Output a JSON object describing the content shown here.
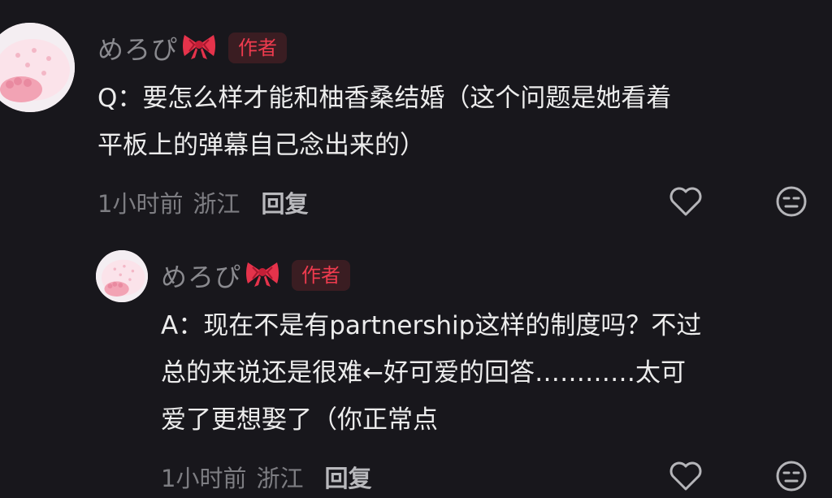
{
  "comments": [
    {
      "username": "めろぴ",
      "badge": "作者",
      "lines": [
        "Q：要怎么样才能和柚香桑结婚（这个问题是她看着",
        "平板上的弹幕自己念出来的）"
      ],
      "time": "1小时前",
      "location": "浙江",
      "reply_label": "回复"
    },
    {
      "username": "めろぴ",
      "badge": "作者",
      "lines": [
        "A：现在不是有partnership这样的制度吗？不过",
        "总的来说还是很难←好可爱的回答…………太可",
        "爱了更想娶了（你正常点"
      ],
      "time": "1小时前",
      "location": "浙江",
      "reply_label": "回复"
    }
  ],
  "colors": {
    "background": "#18171c",
    "badge_text": "#ef3b4e",
    "badge_bg": "#3a1d22",
    "username": "#8a8a8f",
    "body_text": "#ececec",
    "meta_text": "#7d7d82"
  },
  "icons": [
    "bow-emoji-icon",
    "heart-outline-icon",
    "neutral-face-icon",
    "cat-paw-avatar-icon"
  ]
}
